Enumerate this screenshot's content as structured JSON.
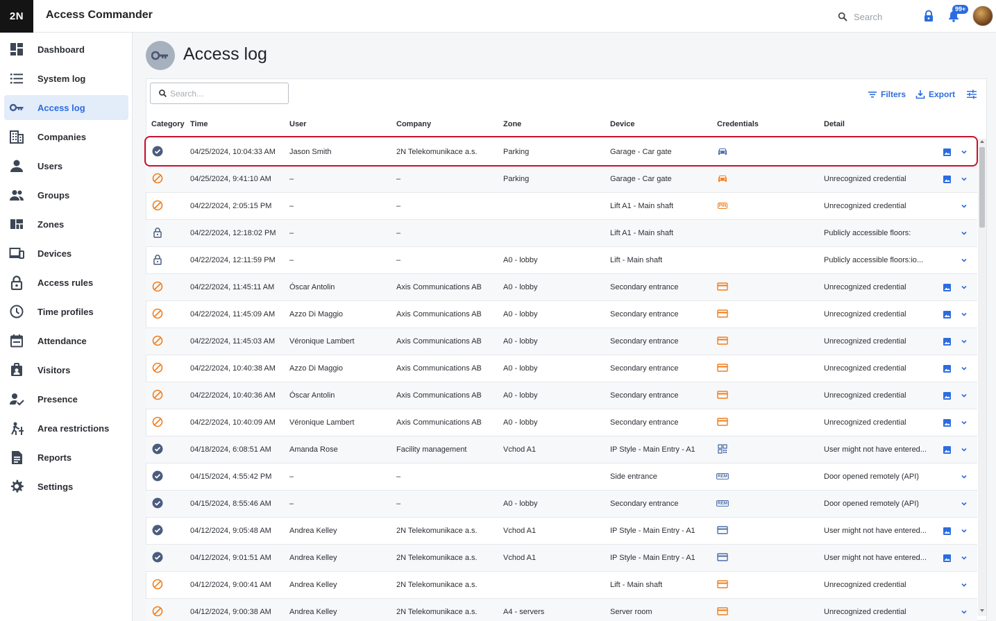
{
  "app": {
    "logo": "2N",
    "title": "Access Commander"
  },
  "topbar": {
    "search_placeholder": "Search",
    "notification_count": "99+"
  },
  "sidebar": {
    "items": [
      {
        "label": "Dashboard",
        "icon": "dashboard-icon"
      },
      {
        "label": "System log",
        "icon": "list-icon"
      },
      {
        "label": "Access log",
        "icon": "key-icon",
        "active": true
      },
      {
        "label": "Companies",
        "icon": "building-icon"
      },
      {
        "label": "Users",
        "icon": "user-icon"
      },
      {
        "label": "Groups",
        "icon": "group-icon"
      },
      {
        "label": "Zones",
        "icon": "zones-icon"
      },
      {
        "label": "Devices",
        "icon": "devices-icon"
      },
      {
        "label": "Access rules",
        "icon": "lock-icon"
      },
      {
        "label": "Time profiles",
        "icon": "clock-icon"
      },
      {
        "label": "Attendance",
        "icon": "calendar-icon"
      },
      {
        "label": "Visitors",
        "icon": "badge-icon"
      },
      {
        "label": "Presence",
        "icon": "presence-icon"
      },
      {
        "label": "Area restrictions",
        "icon": "area-icon"
      },
      {
        "label": "Reports",
        "icon": "report-icon"
      },
      {
        "label": "Settings",
        "icon": "gear-icon"
      }
    ]
  },
  "page": {
    "title": "Access log"
  },
  "toolbar": {
    "search_placeholder": "Search...",
    "filters_label": "Filters",
    "export_label": "Export"
  },
  "table": {
    "columns": [
      "Category",
      "Time",
      "User",
      "Company",
      "Zone",
      "Device",
      "Credentials",
      "Detail"
    ],
    "rows": [
      {
        "category": "granted",
        "time": "04/25/2024, 10:04:33 AM",
        "user": "Jason Smith",
        "company": "2N Telekomunikace a.s.",
        "zone": "Parking",
        "device": "Garage - Car gate",
        "cred": "car",
        "cred_color": "blue",
        "detail": "",
        "image": true
      },
      {
        "category": "denied",
        "time": "04/25/2024, 9:41:10 AM",
        "user": "–",
        "company": "–",
        "zone": "Parking",
        "device": "Garage - Car gate",
        "cred": "car",
        "cred_color": "orange",
        "detail": "Unrecognized credential",
        "image": true
      },
      {
        "category": "denied",
        "time": "04/22/2024, 2:05:15 PM",
        "user": "–",
        "company": "–",
        "zone": "",
        "device": "Lift A1 - Main shaft",
        "cred": "pin",
        "cred_color": "orange",
        "detail": "Unrecognized credential",
        "image": false
      },
      {
        "category": "unlocked",
        "time": "04/22/2024, 12:18:02 PM",
        "user": "–",
        "company": "–",
        "zone": "",
        "device": "Lift A1 - Main shaft",
        "cred": "",
        "cred_color": "",
        "detail": "Publicly accessible floors:",
        "image": false
      },
      {
        "category": "unlocked",
        "time": "04/22/2024, 12:11:59 PM",
        "user": "–",
        "company": "–",
        "zone": "A0 - lobby",
        "device": "Lift - Main shaft",
        "cred": "",
        "cred_color": "",
        "detail": "Publicly accessible floors:io...",
        "image": false
      },
      {
        "category": "denied",
        "time": "04/22/2024, 11:45:11 AM",
        "user": "Óscar Antolin",
        "company": "Axis Communications AB",
        "zone": "A0 - lobby",
        "device": "Secondary entrance",
        "cred": "card",
        "cred_color": "orange",
        "detail": "Unrecognized credential",
        "image": true
      },
      {
        "category": "denied",
        "time": "04/22/2024, 11:45:09 AM",
        "user": "Azzo Di Maggio",
        "company": "Axis Communications AB",
        "zone": "A0 - lobby",
        "device": "Secondary entrance",
        "cred": "card",
        "cred_color": "orange",
        "detail": "Unrecognized credential",
        "image": true
      },
      {
        "category": "denied",
        "time": "04/22/2024, 11:45:03 AM",
        "user": "Véronique Lambert",
        "company": "Axis Communications AB",
        "zone": "A0 - lobby",
        "device": "Secondary entrance",
        "cred": "card",
        "cred_color": "orange",
        "detail": "Unrecognized credential",
        "image": true
      },
      {
        "category": "denied",
        "time": "04/22/2024, 10:40:38 AM",
        "user": "Azzo Di Maggio",
        "company": "Axis Communications AB",
        "zone": "A0 - lobby",
        "device": "Secondary entrance",
        "cred": "card",
        "cred_color": "orange",
        "detail": "Unrecognized credential",
        "image": true
      },
      {
        "category": "denied",
        "time": "04/22/2024, 10:40:36 AM",
        "user": "Óscar Antolin",
        "company": "Axis Communications AB",
        "zone": "A0 - lobby",
        "device": "Secondary entrance",
        "cred": "card",
        "cred_color": "orange",
        "detail": "Unrecognized credential",
        "image": true
      },
      {
        "category": "denied",
        "time": "04/22/2024, 10:40:09 AM",
        "user": "Véronique Lambert",
        "company": "Axis Communications AB",
        "zone": "A0 - lobby",
        "device": "Secondary entrance",
        "cred": "card",
        "cred_color": "orange",
        "detail": "Unrecognized credential",
        "image": true
      },
      {
        "category": "granted",
        "time": "04/18/2024, 6:08:51 AM",
        "user": "Amanda Rose",
        "company": "Facility management",
        "zone": "Vchod A1",
        "device": "IP Style - Main Entry - A1",
        "cred": "qr",
        "cred_color": "blue",
        "detail": "User might not have entered...",
        "image": true
      },
      {
        "category": "granted",
        "time": "04/15/2024, 4:55:42 PM",
        "user": "–",
        "company": "–",
        "zone": "",
        "device": "Side entrance",
        "cred": "rem",
        "cred_color": "blue",
        "detail": "Door opened remotely (API)",
        "image": false
      },
      {
        "category": "granted",
        "time": "04/15/2024, 8:55:46 AM",
        "user": "–",
        "company": "–",
        "zone": "A0 - lobby",
        "device": "Secondary entrance",
        "cred": "rem",
        "cred_color": "blue",
        "detail": "Door opened remotely (API)",
        "image": false
      },
      {
        "category": "granted",
        "time": "04/12/2024, 9:05:48 AM",
        "user": "Andrea Kelley",
        "company": "2N Telekomunikace a.s.",
        "zone": "Vchod A1",
        "device": "IP Style - Main Entry - A1",
        "cred": "card",
        "cred_color": "blue",
        "detail": "User might not have entered...",
        "image": true
      },
      {
        "category": "granted",
        "time": "04/12/2024, 9:01:51 AM",
        "user": "Andrea Kelley",
        "company": "2N Telekomunikace a.s.",
        "zone": "Vchod A1",
        "device": "IP Style - Main Entry - A1",
        "cred": "card",
        "cred_color": "blue",
        "detail": "User might not have entered...",
        "image": true
      },
      {
        "category": "denied",
        "time": "04/12/2024, 9:00:41 AM",
        "user": "Andrea Kelley",
        "company": "2N Telekomunikace a.s.",
        "zone": "",
        "device": "Lift - Main shaft",
        "cred": "card",
        "cred_color": "orange",
        "detail": "Unrecognized credential",
        "image": false
      },
      {
        "category": "denied",
        "time": "04/12/2024, 9:00:38 AM",
        "user": "Andrea Kelley",
        "company": "2N Telekomunikace a.s.",
        "zone": "A4 - servers",
        "device": "Server room",
        "cred": "card",
        "cred_color": "orange",
        "detail": "Unrecognized credential",
        "image": false
      }
    ]
  },
  "colors": {
    "accent": "#2b6de0",
    "granted": "#4a5d7e",
    "denied": "#f07d1a",
    "cred_blue": "#4a6ea8",
    "highlight": "#c8102e"
  }
}
